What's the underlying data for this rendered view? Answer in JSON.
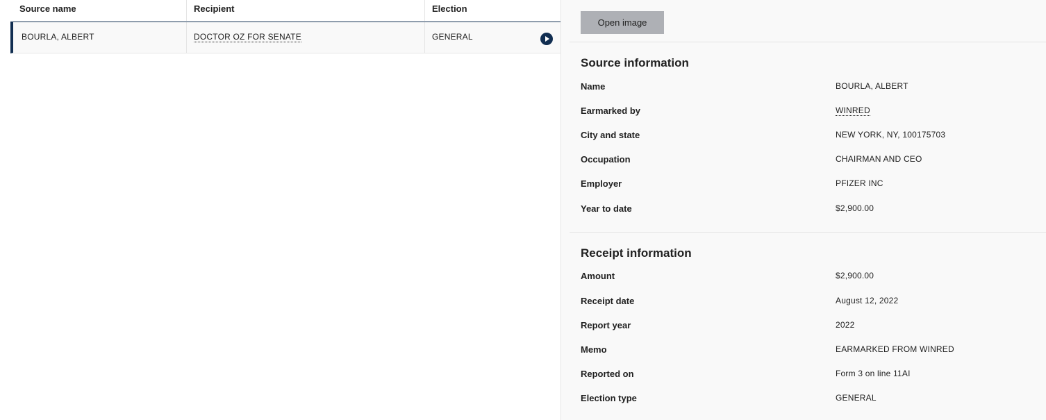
{
  "table": {
    "headers": [
      "Source name",
      "Recipient",
      "Election"
    ],
    "rows": [
      {
        "source_name": "BOURLA, ALBERT",
        "recipient": "DOCTOR OZ FOR SENATE",
        "election": "GENERAL"
      }
    ]
  },
  "panel": {
    "open_image_label": "Open image",
    "source_section": {
      "title": "Source information",
      "fields": [
        {
          "label": "Name",
          "value": "BOURLA, ALBERT"
        },
        {
          "label": "Earmarked by",
          "value": "WINRED"
        },
        {
          "label": "City and state",
          "value": "NEW YORK, NY, 100175703"
        },
        {
          "label": "Occupation",
          "value": "CHAIRMAN AND CEO"
        },
        {
          "label": "Employer",
          "value": "PFIZER INC"
        },
        {
          "label": "Year to date",
          "value": "$2,900.00"
        }
      ]
    },
    "receipt_section": {
      "title": "Receipt information",
      "fields": [
        {
          "label": "Amount",
          "value": "$2,900.00"
        },
        {
          "label": "Receipt date",
          "value": "August 12, 2022"
        },
        {
          "label": "Report year",
          "value": "2022"
        },
        {
          "label": "Memo",
          "value": "EARMARKED FROM WINRED"
        },
        {
          "label": "Reported on",
          "value": "Form 3 on line 11AI"
        },
        {
          "label": "Election type",
          "value": "GENERAL"
        }
      ]
    }
  },
  "colors": {
    "accent_navy": "#112e51",
    "button_gray": "#aeb0b5",
    "panel_bg": "#f9f9f9"
  },
  "icons": {
    "row_action": "play-circle-icon"
  }
}
